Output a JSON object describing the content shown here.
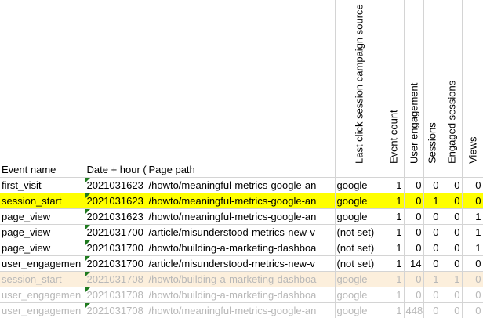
{
  "headers": {
    "event_name": "Event name",
    "date_hour": "Date + hour (",
    "page_path": "Page path",
    "source": "Last click session campaign source",
    "event_count": "Event count",
    "user_engagement": "User engagement",
    "sessions": "Sessions",
    "engaged_sessions": "Engaged sessions",
    "views": "Views"
  },
  "rows": [
    {
      "event": "first_visit",
      "date": "2021031623",
      "path": "/howto/meaningful-metrics-google-an",
      "source": "google",
      "count": "1",
      "engage": "0",
      "sess": "0",
      "engsess": "0",
      "views": "0",
      "style": "normal"
    },
    {
      "event": "session_start",
      "date": "2021031623",
      "path": "/howto/meaningful-metrics-google-an",
      "source": "google",
      "count": "1",
      "engage": "0",
      "sess": "1",
      "engsess": "0",
      "views": "0",
      "style": "highlight"
    },
    {
      "event": "page_view",
      "date": "2021031623",
      "path": "/howto/meaningful-metrics-google-an",
      "source": "google",
      "count": "1",
      "engage": "0",
      "sess": "0",
      "engsess": "0",
      "views": "1",
      "style": "normal"
    },
    {
      "event": "page_view",
      "date": "2021031700",
      "path": "/article/misunderstood-metrics-new-v",
      "source": "(not set)",
      "count": "1",
      "engage": "0",
      "sess": "0",
      "engsess": "0",
      "views": "1",
      "style": "normal"
    },
    {
      "event": "page_view",
      "date": "2021031700",
      "path": "/howto/building-a-marketing-dashboa",
      "source": "(not set)",
      "count": "1",
      "engage": "0",
      "sess": "0",
      "engsess": "0",
      "views": "1",
      "style": "normal"
    },
    {
      "event": "user_engagemen",
      "date": "2021031700",
      "path": "/article/misunderstood-metrics-new-v",
      "source": "(not set)",
      "count": "1",
      "engage": "14",
      "sess": "0",
      "engsess": "0",
      "views": "0",
      "style": "normal"
    },
    {
      "event": "session_start",
      "date": "2021031708",
      "path": "/howto/building-a-marketing-dashboa",
      "source": "google",
      "count": "1",
      "engage": "0",
      "sess": "1",
      "engsess": "1",
      "views": "0",
      "style": "faded-tan"
    },
    {
      "event": "user_engagemen",
      "date": "2021031708",
      "path": "/howto/building-a-marketing-dashboa",
      "source": "google",
      "count": "1",
      "engage": "0",
      "sess": "0",
      "engsess": "0",
      "views": "0",
      "style": "faded"
    },
    {
      "event": "user_engagemen",
      "date": "2021031708",
      "path": "/howto/meaningful-metrics-google-an",
      "source": "google",
      "count": "1",
      "engage": "448",
      "sess": "0",
      "engsess": "0",
      "views": "0",
      "style": "faded"
    }
  ],
  "colors": {
    "highlight": "#ffff00",
    "faded_tan": "#fcefdc",
    "faded_text": "#b8b8b8",
    "gridline": "#d4d4d4",
    "error_marker": "#1f7a1f"
  }
}
